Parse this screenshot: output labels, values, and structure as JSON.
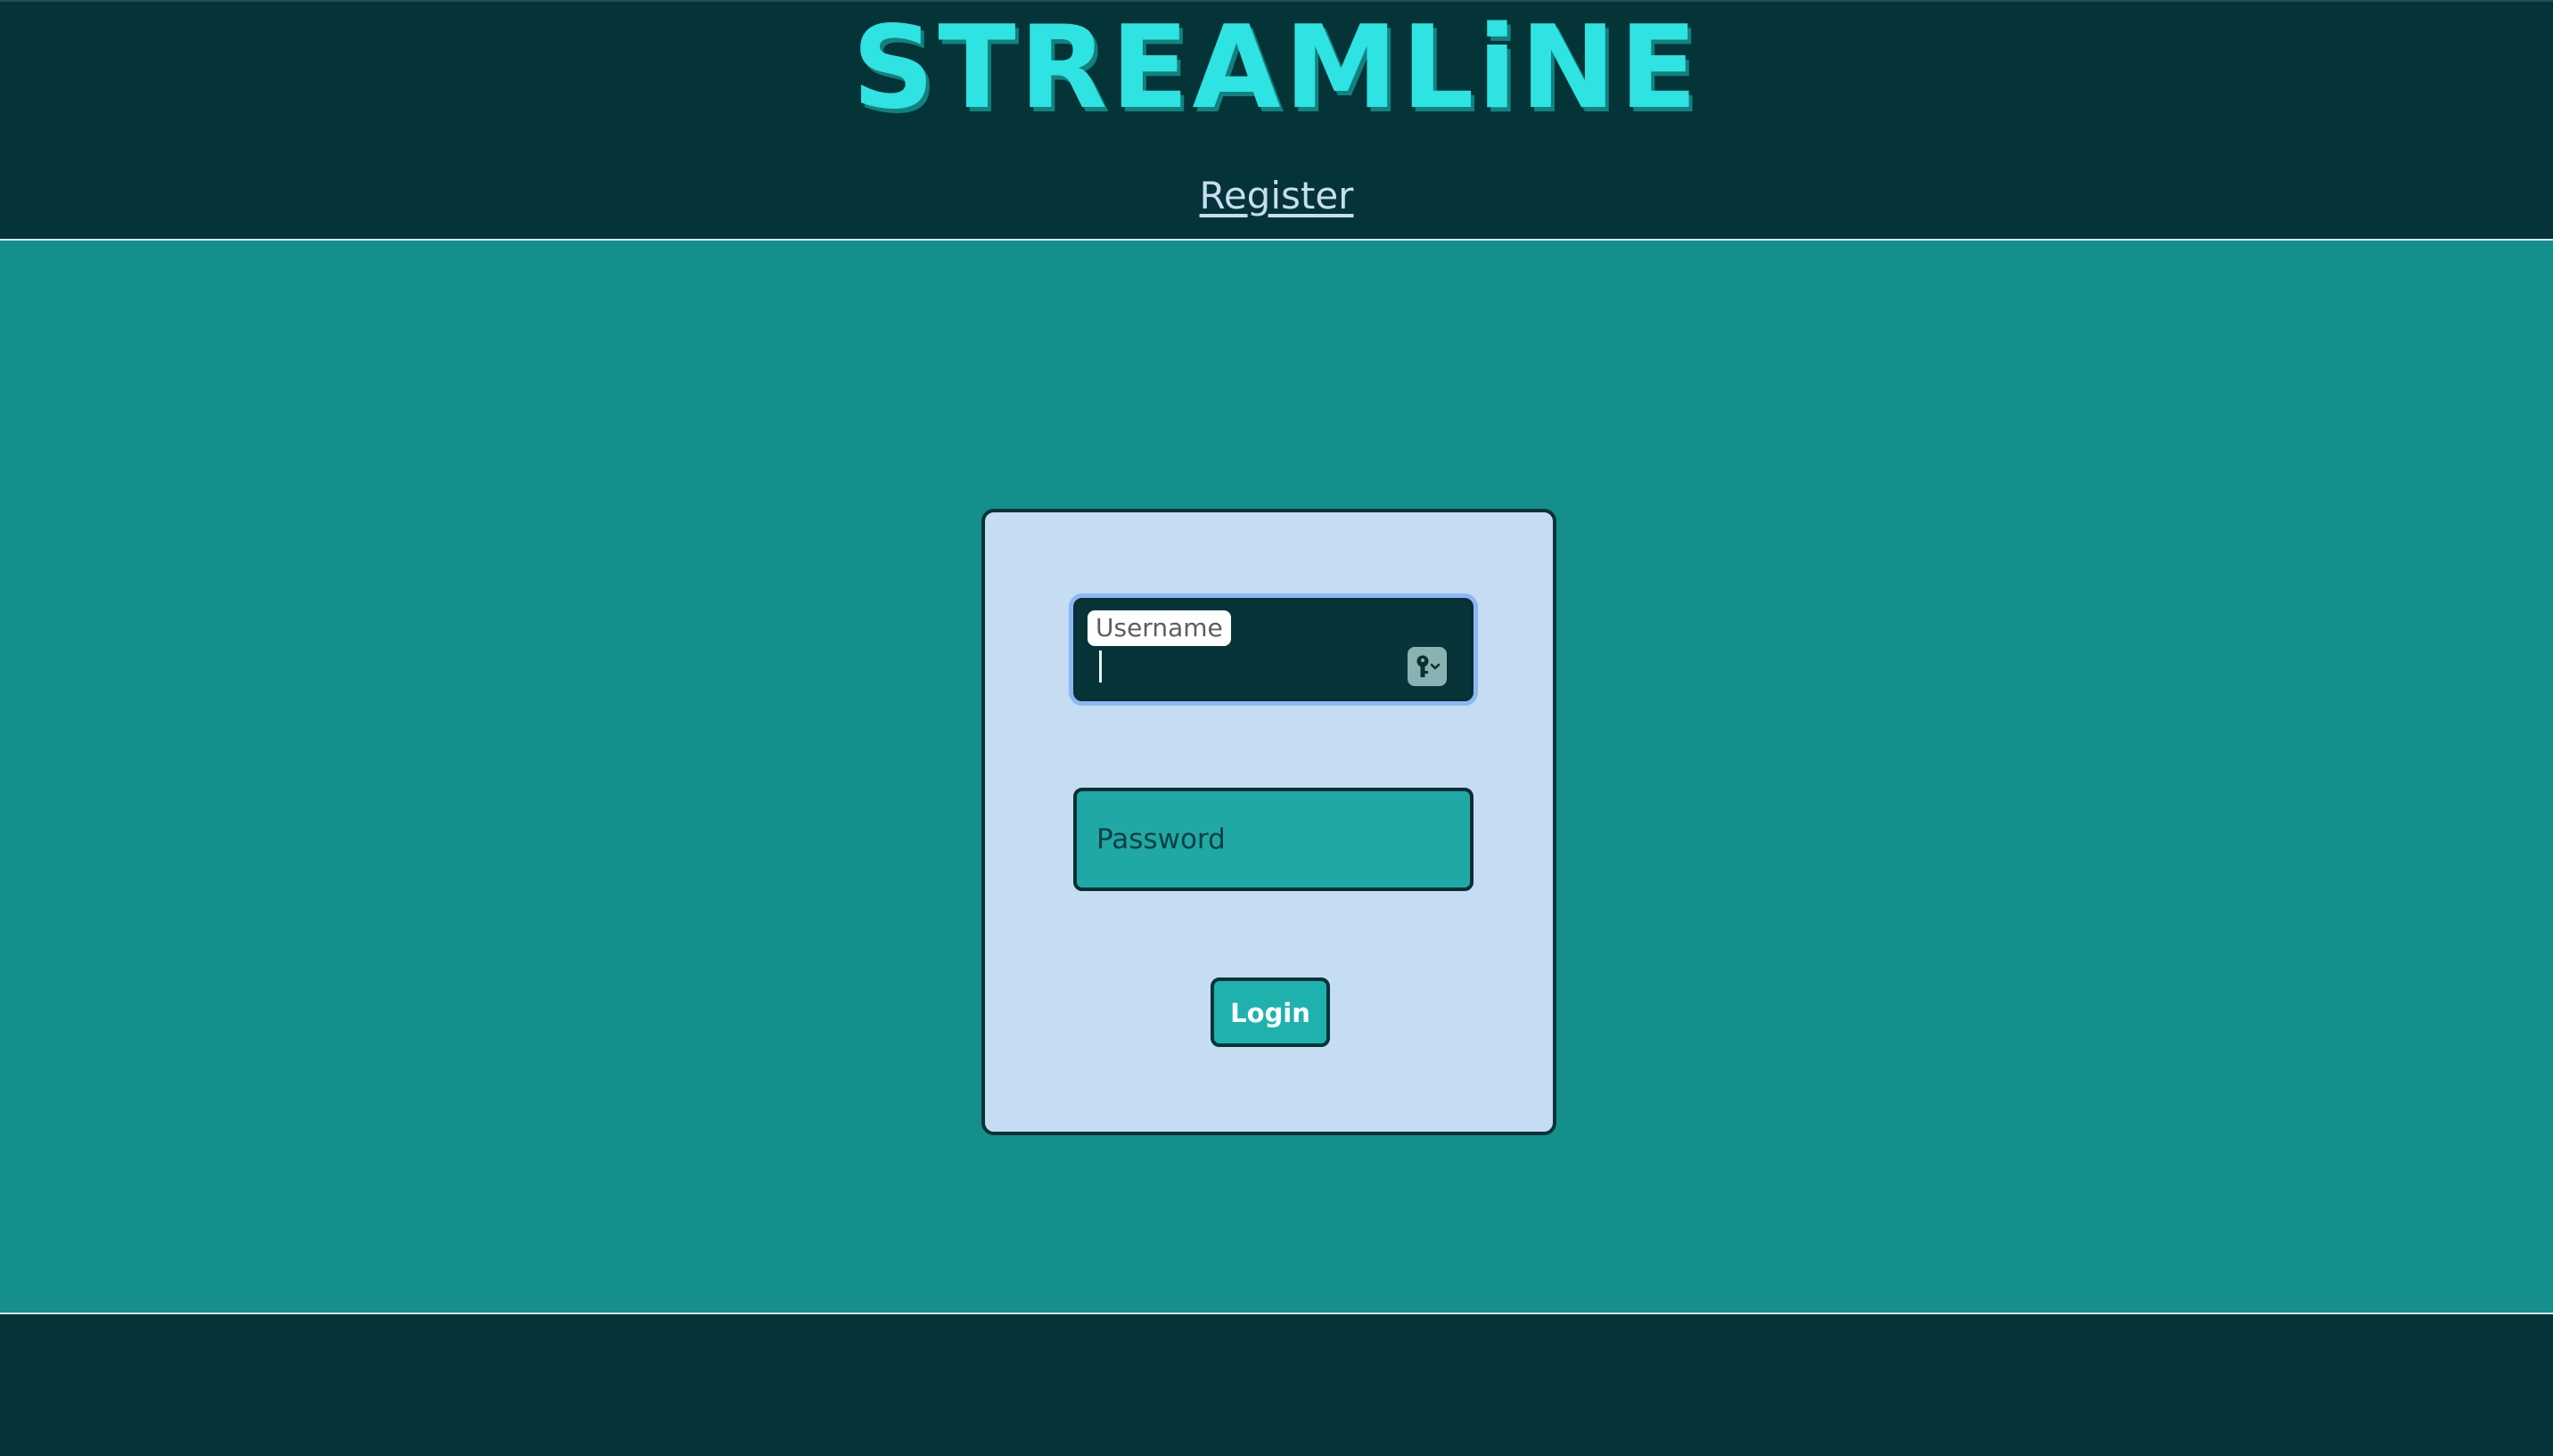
{
  "header": {
    "brand": "STREAMLiNE",
    "register_label": "Register"
  },
  "login_form": {
    "username_label": "Username",
    "username_value": "",
    "password_placeholder": "Password",
    "login_label": "Login"
  },
  "colors": {
    "header_bg": "#043437",
    "page_bg": "#148f8b",
    "brand": "#2ee3e1",
    "card_bg": "#c6dcf2",
    "button_bg": "#1fb1ae"
  },
  "icons": {
    "password_manager": "key-icon"
  }
}
